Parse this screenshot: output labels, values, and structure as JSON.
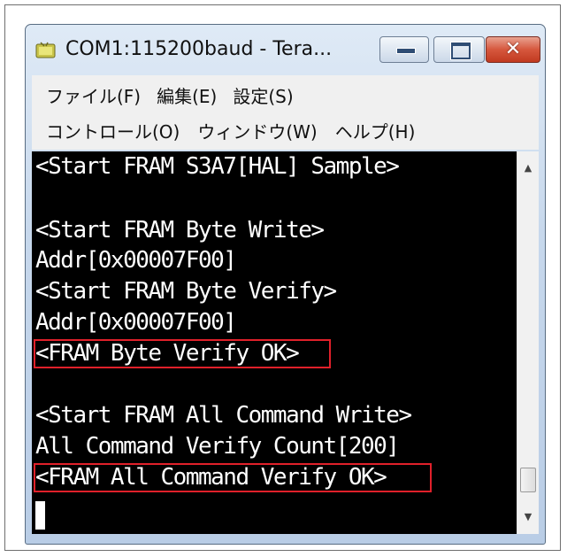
{
  "window": {
    "title": "COM1:115200baud - Tera...",
    "close_glyph": "✕"
  },
  "menu": {
    "row1": [
      {
        "label": "ファイル(F)"
      },
      {
        "label": "編集(E)"
      },
      {
        "label": "設定(S)"
      }
    ],
    "row2": [
      {
        "label": "コントロール(O)"
      },
      {
        "label": "ウィンドウ(W)"
      },
      {
        "label": "ヘルプ(H)"
      }
    ]
  },
  "terminal": {
    "lines": [
      "<Start FRAM S3A7[HAL] Sample>",
      "",
      "<Start FRAM Byte Write>",
      "Addr[0x00007F00]",
      "<Start FRAM Byte Verify>",
      "Addr[0x00007F00]",
      "<FRAM Byte Verify OK>",
      "",
      "<Start FRAM All Command Write>",
      "All Command Verify Count[200]",
      "<FRAM All Command Verify OK>"
    ],
    "highlight_color": "#e0202a"
  },
  "scrollbar": {
    "up_arrow": "▲",
    "down_arrow": "▼"
  },
  "colors": {
    "terminal_bg": "#000000",
    "terminal_fg": "#ffffff",
    "close_button": "#c13a20"
  },
  "icons": {
    "app": "teraterm-icon",
    "minimize": "minimize-icon",
    "maximize": "maximize-icon",
    "close": "close-icon"
  }
}
